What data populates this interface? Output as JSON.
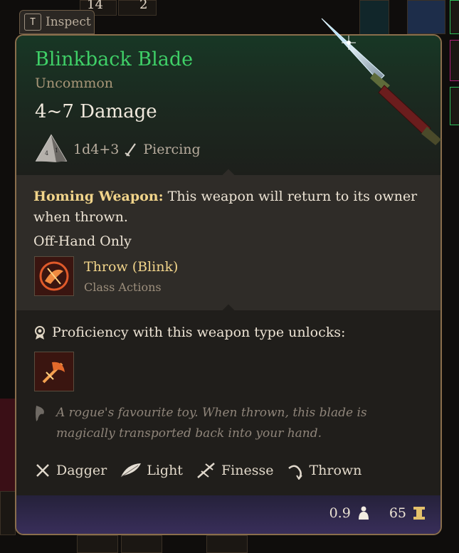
{
  "background": {
    "counts": [
      "14",
      "2"
    ]
  },
  "inspect_tab": {
    "key": "T",
    "label": "Inspect"
  },
  "item": {
    "name": "Blinkback Blade",
    "rarity": "Uncommon",
    "damage": "4~7 Damage",
    "dice": "1d4+3",
    "damage_type": "Piercing",
    "name_color": "#3fcf67",
    "rarity_color": "#a89678"
  },
  "properties_section": {
    "homing_label": "Homing Weapon:",
    "homing_text": " This weapon will return to its owner when thrown.",
    "off_hand": "Off-Hand Only",
    "action": {
      "name": "Throw (Blink)",
      "category": "Class Actions",
      "icon": "throw-blink-icon"
    }
  },
  "proficiency": {
    "text": "Proficiency with this weapon type unlocks:",
    "icon": "proficiency-action-icon"
  },
  "flavor_text": "A rogue's favourite toy. When thrown, this blade is magically transported back into your hand.",
  "weapon_properties": [
    {
      "label": "Dagger",
      "icon": "dagger-icon"
    },
    {
      "label": "Light",
      "icon": "feather-icon"
    },
    {
      "label": "Finesse",
      "icon": "finesse-icon"
    },
    {
      "label": "Thrown",
      "icon": "thrown-icon"
    }
  ],
  "footer": {
    "weight": "0.9",
    "value": "65"
  }
}
